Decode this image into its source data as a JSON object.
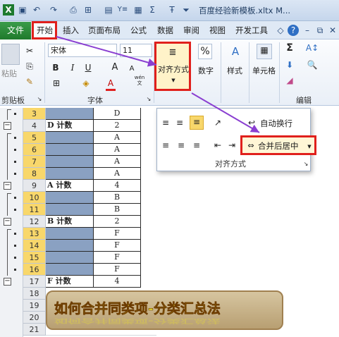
{
  "titlebar": {
    "title": "百度经验新模板.xltx M..."
  },
  "menu": {
    "file": "文件",
    "tabs": [
      "开始",
      "插入",
      "页面布局",
      "公式",
      "数据",
      "审阅",
      "视图",
      "开发工具"
    ]
  },
  "ribbon": {
    "clipboard": {
      "paste": "粘贴",
      "group": "剪贴板"
    },
    "font": {
      "name": "宋体",
      "size": "11",
      "bold": "B",
      "italic": "I",
      "underline": "U",
      "grow": "A",
      "shrink": "A",
      "color_letter": "A",
      "wen": "wén",
      "group": "字体"
    },
    "alignment": {
      "label": "对齐方式"
    },
    "number": {
      "symbol": "%",
      "label": "数字"
    },
    "styles": {
      "label": "样式"
    },
    "cells": {
      "label": "单元格"
    },
    "editing": {
      "sigma": "Σ",
      "group": "编辑"
    }
  },
  "align_popup": {
    "wrap": "自动换行",
    "merge": "合并后居中",
    "group": "对齐方式"
  },
  "sheet": {
    "rows": [
      {
        "num": "3",
        "b": "",
        "c": "D",
        "blue": true
      },
      {
        "num": "4",
        "b": "D 计数",
        "c": "2",
        "blue": false
      },
      {
        "num": "5",
        "b": "",
        "c": "A",
        "blue": true
      },
      {
        "num": "6",
        "b": "",
        "c": "A",
        "blue": true
      },
      {
        "num": "7",
        "b": "",
        "c": "A",
        "blue": true
      },
      {
        "num": "8",
        "b": "",
        "c": "A",
        "blue": true
      },
      {
        "num": "9",
        "b": "A 计数",
        "c": "4",
        "blue": false
      },
      {
        "num": "10",
        "b": "",
        "c": "B",
        "blue": true
      },
      {
        "num": "11",
        "b": "",
        "c": "B",
        "blue": true
      },
      {
        "num": "12",
        "b": "B 计数",
        "c": "2",
        "blue": false
      },
      {
        "num": "13",
        "b": "",
        "c": "F",
        "blue": true
      },
      {
        "num": "14",
        "b": "",
        "c": "F",
        "blue": true
      },
      {
        "num": "15",
        "b": "",
        "c": "F",
        "blue": true
      },
      {
        "num": "16",
        "b": "",
        "c": "F",
        "blue": true
      },
      {
        "num": "17",
        "b": "F 计数",
        "c": "4",
        "blue": false
      },
      {
        "num": "18",
        "b": "",
        "c": "",
        "blue": false
      },
      {
        "num": "19",
        "b": "",
        "c": "",
        "blue": false
      },
      {
        "num": "20",
        "b": "",
        "c": "",
        "blue": false
      },
      {
        "num": "21",
        "b": "",
        "c": "",
        "blue": false
      }
    ]
  },
  "banner": {
    "text": "如何合并同类项-分类汇总法"
  },
  "colors": {
    "highlight_red": "#e0201c",
    "arrow_purple": "#8a3fd1",
    "banner_text": "#e8dd34",
    "subtotal_fill": "#8aa1c2",
    "file_tab": "#1f7a2c"
  }
}
